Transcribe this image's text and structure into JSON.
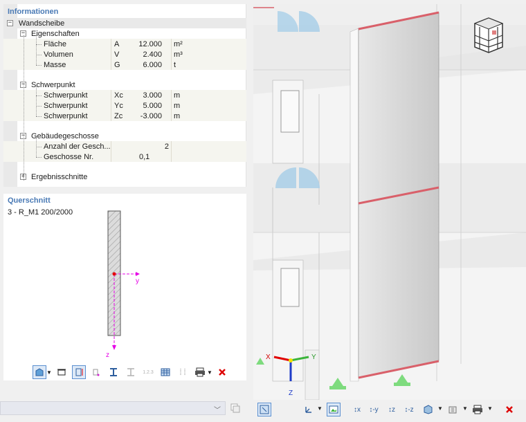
{
  "info_panel": {
    "title": "Informationen",
    "root": "Wandscheibe",
    "groups": {
      "eigenschaften": {
        "label": "Eigenschaften",
        "rows": [
          {
            "name": "Fläche",
            "symbol": "A",
            "value": "12.000",
            "unit": "m²"
          },
          {
            "name": "Volumen",
            "symbol": "V",
            "value": "2.400",
            "unit": "m³"
          },
          {
            "name": "Masse",
            "symbol": "G",
            "value": "6.000",
            "unit": "t"
          }
        ]
      },
      "schwerpunkt": {
        "label": "Schwerpunkt",
        "rows": [
          {
            "name": "Schwerpunkt",
            "symbol": "Xc",
            "value": "3.000",
            "unit": "m"
          },
          {
            "name": "Schwerpunkt",
            "symbol": "Yc",
            "value": "5.000",
            "unit": "m"
          },
          {
            "name": "Schwerpunkt",
            "symbol": "Zc",
            "value": "-3.000",
            "unit": "m"
          }
        ]
      },
      "geschosse": {
        "label": "Gebäudegeschosse",
        "rows": [
          {
            "name": "Anzahl der Gesch...",
            "symbol": "",
            "value": "2",
            "unit": ""
          },
          {
            "name": "Geschosse Nr.",
            "symbol": "",
            "value": "0,1",
            "unit": ""
          }
        ]
      },
      "ergebnisschnitte": {
        "label": "Ergebnisschnitte"
      }
    }
  },
  "section_panel": {
    "title": "Querschnitt",
    "section_name": "3 - R_M1 200/2000",
    "axis_y": "y",
    "axis_z": "z"
  },
  "view3d": {
    "axis_x": "X",
    "axis_y": "Y",
    "axis_z": "Z"
  },
  "icons": {
    "section_toolbar": [
      "section-display-icon",
      "frame-icon",
      "dimension-icon",
      "stress-points-icon",
      "i-beam-icon",
      "i-beam-outline-icon",
      "numbering-icon",
      "table-icon",
      "details-icon",
      "print-icon",
      "close-red-icon"
    ],
    "view_toolbar": [
      "view-select-icon",
      "axis-system-icon",
      "screenshot-icon",
      "view-x-icon",
      "view-minus-y-icon",
      "view-z-icon",
      "view-minus-z-icon",
      "visibility-icon",
      "render-icon",
      "print-icon",
      "close-red-icon"
    ]
  },
  "colors": {
    "title": "#4a7ab5",
    "section_axis": "#e600e6",
    "highlight_edge": "#d9606a",
    "support_green": "#7edb7e"
  }
}
